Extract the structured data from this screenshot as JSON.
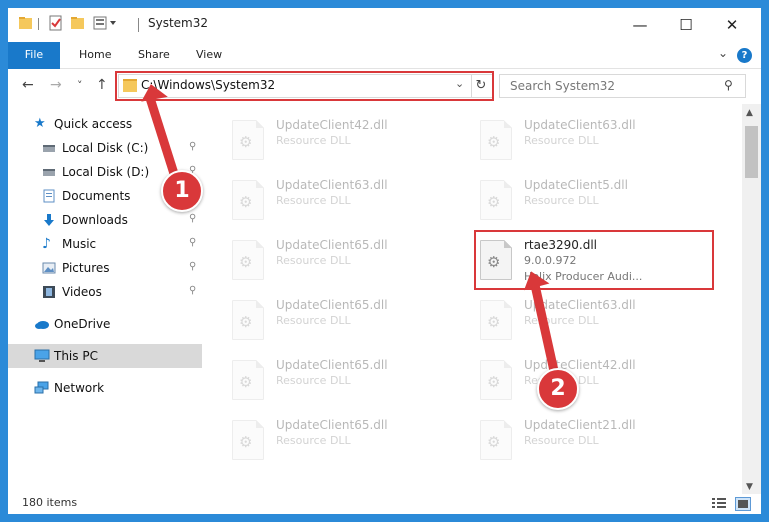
{
  "window": {
    "title": "System32",
    "minimize": "—",
    "maximize": "☐",
    "close": "✕"
  },
  "ribbon": {
    "tabs": [
      "File",
      "Home",
      "Share",
      "View"
    ],
    "expand": "⌄",
    "help": "?"
  },
  "nav": {
    "back": "←",
    "forward": "→",
    "recent": "˅",
    "up": "↑",
    "address": "C:\\Windows\\System32",
    "address_dropdown": "⌄",
    "refresh": "↻",
    "search_placeholder": "Search System32",
    "search_icon": "⚲"
  },
  "sidebar": {
    "items": [
      {
        "label": "Quick access",
        "icon": "star-icon"
      },
      {
        "label": "Local Disk (C:)",
        "icon": "drive-icon",
        "pinned": true
      },
      {
        "label": "Local Disk (D:)",
        "icon": "drive-icon",
        "pinned": true
      },
      {
        "label": "Documents",
        "icon": "documents-icon",
        "pinned": true
      },
      {
        "label": "Downloads",
        "icon": "downloads-icon",
        "pinned": true
      },
      {
        "label": "Music",
        "icon": "music-icon",
        "pinned": true
      },
      {
        "label": "Pictures",
        "icon": "pictures-icon",
        "pinned": true
      },
      {
        "label": "Videos",
        "icon": "videos-icon",
        "pinned": true
      },
      {
        "label": "OneDrive",
        "icon": "cloud-icon"
      },
      {
        "label": "This PC",
        "icon": "computer-icon",
        "selected": true
      },
      {
        "label": "Network",
        "icon": "network-icon"
      }
    ],
    "pin_glyph": "📌"
  },
  "files": [
    {
      "name": "UpdateClient42.dll",
      "desc": "Resource DLL"
    },
    {
      "name": "UpdateClient63.dll",
      "desc": "Resource DLL"
    },
    {
      "name": "UpdateClient63.dll",
      "desc": "Resource DLL"
    },
    {
      "name": "UpdateClient5.dll",
      "desc": "Resource DLL"
    },
    {
      "name": "UpdateClient65.dll",
      "desc": "Resource DLL"
    },
    {
      "name": "rtae3290.dll",
      "version": "9.0.0.972",
      "desc": "Helix Producer Audi...",
      "highlighted": true
    },
    {
      "name": "UpdateClient65.dll",
      "desc": "Resource DLL"
    },
    {
      "name": "UpdateClient63.dll",
      "desc": "Resource DLL"
    },
    {
      "name": "UpdateClient65.dll",
      "desc": "Resource DLL"
    },
    {
      "name": "UpdateClient42.dll",
      "desc": "Resource DLL"
    },
    {
      "name": "UpdateClient65.dll",
      "desc": "Resource DLL"
    },
    {
      "name": "UpdateClient21.dll",
      "desc": "Resource DLL"
    }
  ],
  "gear_glyph": "⚙",
  "status": {
    "count": "180 items"
  },
  "annotations": {
    "step1": "1",
    "step2": "2",
    "color": "#d9383a"
  },
  "colors": {
    "accent": "#1979ca",
    "desktop": "#2b8ad8",
    "selected_bg": "#d9d9d9"
  }
}
